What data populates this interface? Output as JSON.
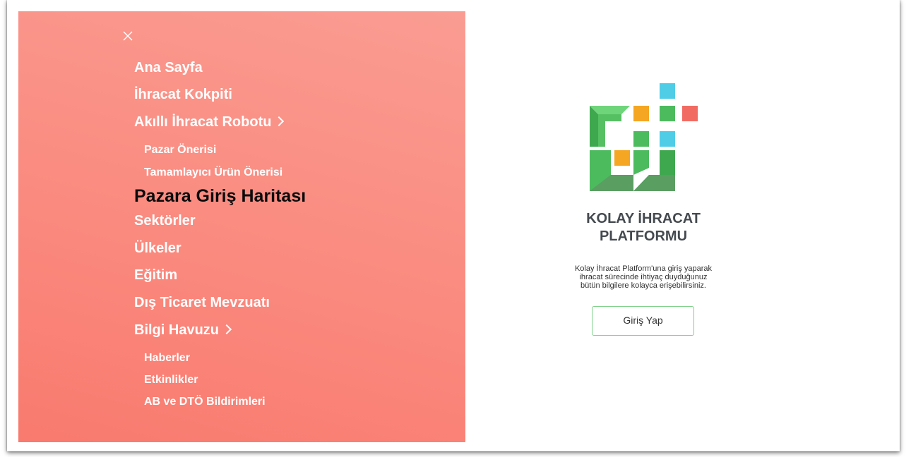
{
  "menu": {
    "close_icon": "close-icon",
    "items": {
      "home": "Ana Sayfa",
      "cockpit": "İhracat Kokpiti",
      "robot": "Akıllı İhracat Robotu",
      "market_suggestion": "Pazar Önerisi",
      "complementary_product": "Tamamlayıcı Ürün Önerisi",
      "market_entry_map": "Pazara Giriş Haritası",
      "sectors": "Sektörler",
      "countries": "Ülkeler",
      "education": "Eğitim",
      "foreign_trade_legislation": "Dış Ticaret Mevzuatı",
      "knowledge_pool": "Bilgi Havuzu",
      "news": "Haberler",
      "events": "Etkinlikler",
      "eu_wto_notifications": "AB ve DTÖ Bildirimleri"
    },
    "active_item": "Pazara Giriş Haritası",
    "colors": {
      "panel_gradient_start": "#f97a6e",
      "panel_gradient_end": "#fa9c92",
      "text": "#ffffff",
      "active_text": "#0b0b0b"
    }
  },
  "brand": {
    "title_line1": "KOLAY İHRACAT",
    "title_line2": "PLATFORMU",
    "description_line1": "Kolay İhracat Platform'una giriş yaparak",
    "description_line2": "ihracat sürecinde ihtiyaç duyduğunuz",
    "description_line3": "bütün bilgilere kolayca erişebilirsiniz.",
    "login_label": "Giriş Yap",
    "colors": {
      "green": "#4cbb5e",
      "light_green": "#6fd57a",
      "orange": "#f5a623",
      "cyan": "#4fcde6",
      "red": "#f26b63"
    }
  }
}
